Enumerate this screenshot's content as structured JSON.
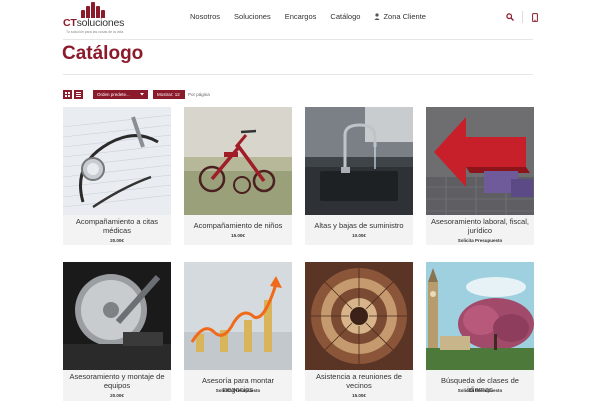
{
  "header": {
    "logo_prefix": "CT",
    "logo_suffix": "soluciones",
    "logo_tagline": "Tu solución para las cosas de la vida",
    "nav": [
      "Nosotros",
      "Soluciones",
      "Encargos",
      "Catálogo"
    ],
    "zone_label": "Zona Cliente"
  },
  "page_title": "Catálogo",
  "toolbar": {
    "order_label": "Orden predete...",
    "show_label": "Mostrar: 12",
    "per_page": "Por página"
  },
  "colors": {
    "brand": "#8b1a2b"
  },
  "products": [
    {
      "name": "Acompañamiento a citas médicas",
      "price": "20.00€",
      "image": "stethoscope-photo"
    },
    {
      "name": "Acompañamiento de niños",
      "price": "15.00€",
      "image": "red-tricycle-photo"
    },
    {
      "name": "Altas y bajas de suministro",
      "price": "10.00€",
      "image": "kitchen-faucet-photo"
    },
    {
      "name": "Asesoramiento laboral, fiscal, jurídico",
      "price": "Solicita Presupuesto",
      "image": "red-arrow-photo"
    },
    {
      "name": "Asesoramiento y montaje de equipos",
      "price": "20.00€",
      "image": "hard-drive-photo"
    },
    {
      "name": "Asesoría para montar negocios",
      "price": "Solicita Presupuesto",
      "image": "growth-chart-photo"
    },
    {
      "name": "Asistencia a reuniones de vecinos",
      "price": "15.00€",
      "image": "spiral-staircase-photo"
    },
    {
      "name": "Búsqueda de clases de idiomas",
      "price": "Solicita Presupuesto",
      "image": "london-big-ben-photo"
    }
  ]
}
